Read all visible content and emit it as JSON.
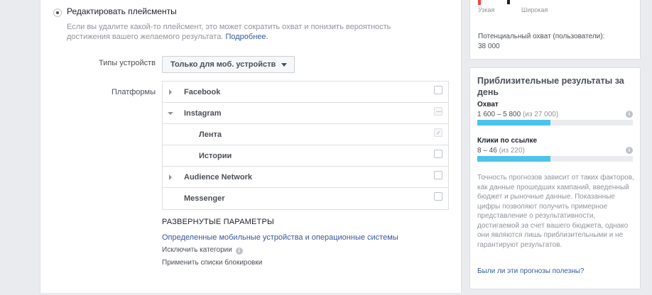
{
  "placements": {
    "radio_label": "Редактировать плейсменты",
    "help_text": "Если вы удалите какой-то плейсмент, это может сократить охват и понизить вероятность достижения вашего желаемого результата.",
    "more_link": "Подробнее."
  },
  "devices": {
    "label": "Типы устройств",
    "selected": "Только для моб. устройств"
  },
  "platforms": {
    "label": "Платформы",
    "rows": [
      {
        "label": "Facebook",
        "arrow": "right",
        "checked": false
      },
      {
        "label": "Instagram",
        "arrow": "down",
        "checked": false
      },
      {
        "label": "Лента",
        "arrow": "none",
        "checked": true
      },
      {
        "label": "Истории",
        "arrow": "none",
        "checked": false
      },
      {
        "label": "Audience Network",
        "arrow": "right",
        "checked": false
      },
      {
        "label": "Messenger",
        "arrow": "none",
        "checked": false
      }
    ]
  },
  "advanced": {
    "title": "РАЗВЕРНУТЫЕ ПАРАМЕТРЫ",
    "devices_link": "Определенные мобильные устройства и операционные системы",
    "exclude_categories": "Исключить категории",
    "block_lists": "Применить списки блокировки"
  },
  "audience": {
    "narrow": "Узкая",
    "broad": "Широкая",
    "potential_reach_label": "Потенциальный охват (пользователи):",
    "potential_reach_value": "38 000"
  },
  "results": {
    "title": "Приблизительные результаты за день",
    "reach": {
      "title": "Охват",
      "value": "1 600 – 5 800",
      "sub": "(из 27 000)",
      "fill": 0.47
    },
    "clicks": {
      "title": "Клики по ссылке",
      "value": "8 – 46",
      "sub": "(из 220)",
      "fill": 0.47
    },
    "disclaimer": "Точность прогнозов зависит от таких факторов, как данные прошедших кампаний, введенный бюджет и рыночные данные. Показанные цифры позволяют получить примерное представление о результативности, достигаемой за счет вашего бюджета, однако они являются лишь приблизительными и не гарантируют результатов.",
    "feedback_link": "Были ли эти прогнозы полезны?"
  }
}
